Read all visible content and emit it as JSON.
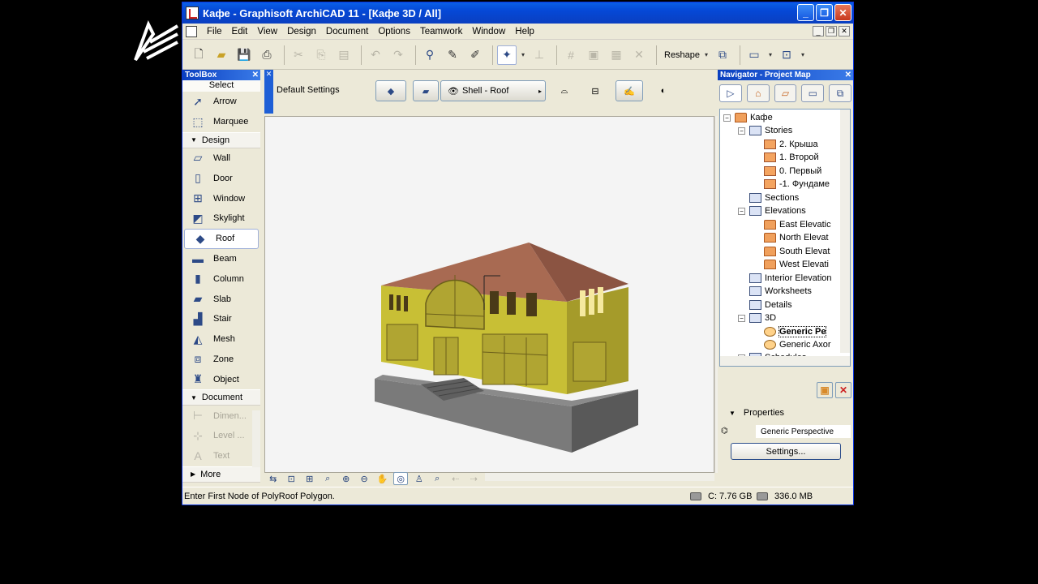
{
  "window": {
    "title": "Кафе - Graphisoft ArchiCAD 11 - [Кафе 3D / All]",
    "minimize_label": "_",
    "restore_label": "❐",
    "close_label": "✕"
  },
  "menubar": {
    "items": [
      "File",
      "Edit",
      "View",
      "Design",
      "Document",
      "Options",
      "Teamwork",
      "Window",
      "Help"
    ]
  },
  "toolbar": {
    "reshape_label": "Reshape"
  },
  "toolbox": {
    "title": "ToolBox",
    "select_label": "Select",
    "arrow": "Arrow",
    "marquee": "Marquee",
    "design_group": "Design",
    "tools": [
      "Wall",
      "Door",
      "Window",
      "Skylight",
      "Roof",
      "Beam",
      "Column",
      "Slab",
      "Stair",
      "Mesh",
      "Zone",
      "Object"
    ],
    "selected_tool": "Roof",
    "document_group": "Document",
    "doc_tools": [
      "Dimen...",
      "Level ...",
      "Text"
    ],
    "more_label": "More"
  },
  "infobox": {
    "default_settings": "Default Settings",
    "shell_layer": "Shell - Roof"
  },
  "navigator": {
    "title": "Navigator - Project Map",
    "tree": {
      "root": "Кафе",
      "stories": "Stories",
      "story_items": [
        "2. Крыша",
        "1. Второй",
        "0. Первый",
        "-1. Фундаме"
      ],
      "sections": "Sections",
      "elevations": "Elevations",
      "elevation_items": [
        "East Elevatic",
        "North Elevat",
        "South Elevat",
        "West Elevati"
      ],
      "interior_elevations": "Interior Elevation",
      "worksheets": "Worksheets",
      "details": "Details",
      "threed": "3D",
      "threed_items": [
        "Generic Pe",
        "Generic Axor"
      ],
      "schedules": "Schedules"
    },
    "properties_label": "Properties",
    "properties_value": "Generic Perspective",
    "settings_button": "Settings..."
  },
  "statusbar": {
    "prompt": "Enter First Node of PolyRoof Polygon.",
    "disk": "C: 7.76 GB",
    "memory": "336.0 MB"
  },
  "colors": {
    "titlebar": "#0548d6",
    "wall_yellow": "#c9c23a",
    "roof_brown": "#a96a52",
    "foundation_gray": "#6b6b6b"
  }
}
